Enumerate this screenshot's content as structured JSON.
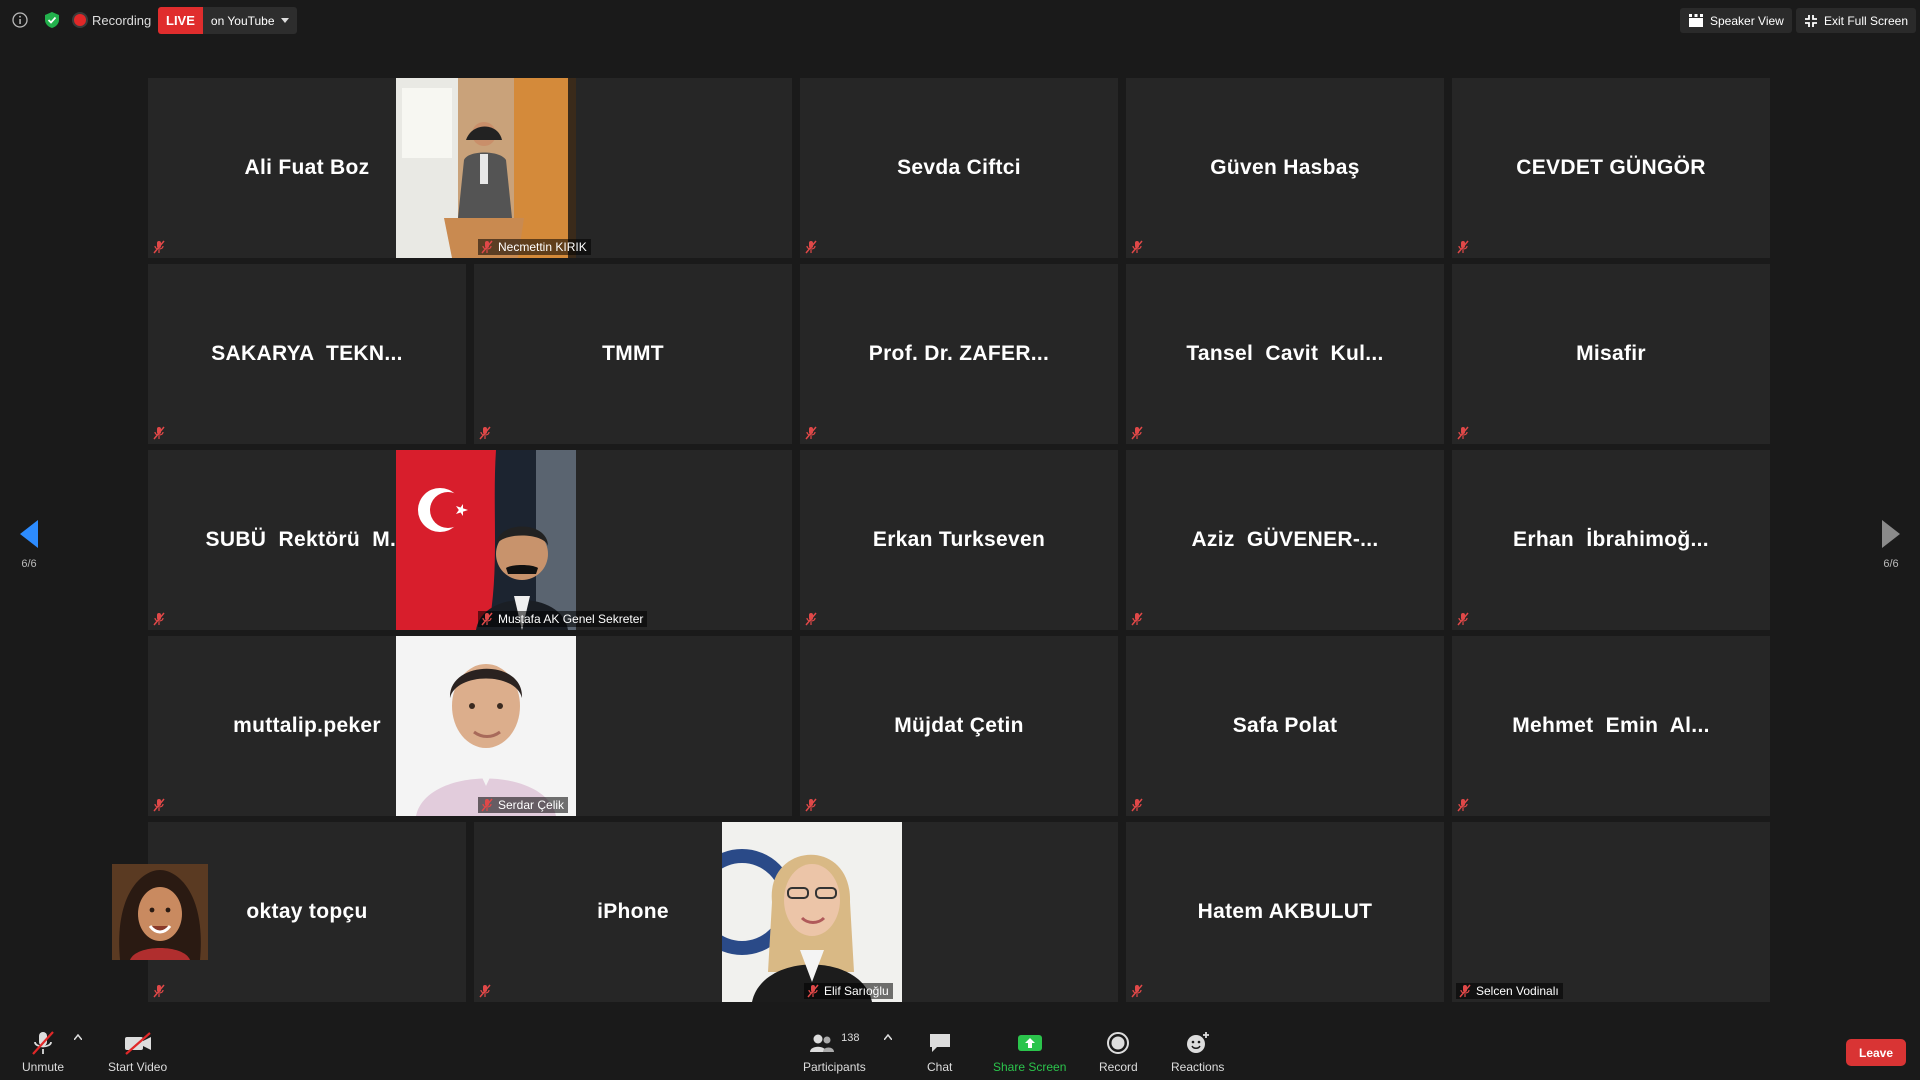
{
  "top": {
    "recording_label": "Recording",
    "live_label": "LIVE",
    "live_destination": "on YouTube",
    "speaker_view": "Speaker View",
    "exit_full_screen": "Exit Full Screen"
  },
  "pagination": {
    "left": "6/6",
    "right": "6/6"
  },
  "tiles": [
    {
      "name": "Ali Fuat Boz"
    },
    {
      "name": "Necmettin KIRIK",
      "video": "podium"
    },
    {
      "name": "Sevda Ciftci"
    },
    {
      "name": "Güven Hasbaş"
    },
    {
      "name": "CEVDET GÜNGÖR"
    },
    {
      "name": "SAKARYA  TEKN..."
    },
    {
      "name": "TMMT"
    },
    {
      "name": "Prof. Dr. ZAFER..."
    },
    {
      "name": "Tansel  Cavit  Kul..."
    },
    {
      "name": "Misafir"
    },
    {
      "name": "SUBÜ  Rektörü  M..."
    },
    {
      "name": "Mustafa AK Genel Sekreter",
      "video": "flag"
    },
    {
      "name": "Erkan Turkseven"
    },
    {
      "name": "Aziz  GÜVENER-..."
    },
    {
      "name": "Erhan  İbrahimoğ..."
    },
    {
      "name": "muttalip.peker"
    },
    {
      "name": "Serdar Çelik",
      "video": "portrait"
    },
    {
      "name": "Müjdat Çetin"
    },
    {
      "name": "Safa Polat"
    },
    {
      "name": "Mehmet  Emin  Al..."
    },
    {
      "name": "oktay topçu"
    },
    {
      "name": "iPhone"
    },
    {
      "name": "Elif Sarıoğlu",
      "video": "woman"
    },
    {
      "name": "Hatem AKBULUT"
    },
    {
      "name": "Selcen Vodinalı",
      "video": "avatar"
    }
  ],
  "bottom": {
    "unmute": "Unmute",
    "start_video": "Start Video",
    "participants": "Participants",
    "participants_count": "138",
    "chat": "Chat",
    "share_screen": "Share Screen",
    "record": "Record",
    "reactions": "Reactions",
    "leave": "Leave"
  },
  "colors": {
    "accent_live": "#e02d2d",
    "share_green": "#2bc44c",
    "leave_red": "#d93434",
    "nav_blue": "#2d8cff"
  }
}
